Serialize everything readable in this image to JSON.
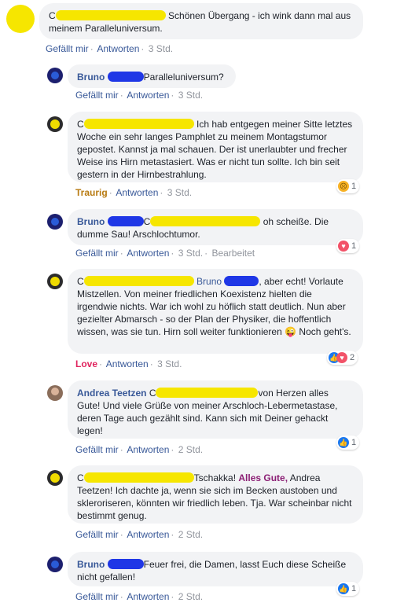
{
  "comments": [
    {
      "text": "Schönen Übergang - ich wink dann mal aus meinem Paralleluniversum.",
      "initial": "C",
      "actions": {
        "like": "Gefällt mir",
        "reply": "Antworten",
        "time": "3 Std."
      }
    },
    {
      "author": "Bruno",
      "text": "Paralleluniversum?",
      "actions": {
        "like": "Gefällt mir",
        "reply": "Antworten",
        "time": "3 Std."
      }
    },
    {
      "initial": "C",
      "text": "Ich hab entgegen meiner Sitte letztes Woche ein sehr langes Pamphlet zu meinem Montagstumor gepostet. Kannst ja mal schauen. Der ist unerlaubter und frecher Weise ins Hirn metastasiert. Was er nicht tun sollte. Ich bin seit gestern in der Hirnbestrahlung.",
      "actions": {
        "reaction": "Traurig",
        "reply": "Antworten",
        "time": "3 Std."
      },
      "badge_count": "1"
    },
    {
      "author": "Bruno",
      "initial": "C",
      "text": "oh scheiße. Die dumme Sau! Arschlochtumor.",
      "actions": {
        "like": "Gefällt mir",
        "reply": "Antworten",
        "time": "3 Std.",
        "edited": "Bearbeitet"
      },
      "badge_count": "1"
    },
    {
      "initial": "C",
      "mention": "Bruno",
      "text": ", aber echt! Vorlaute Mistzellen. Von meiner friedlichen Koexistenz hielten die irgendwie nichts. War ich wohl zu höflich statt deutlich. Nun aber gezielter Abmarsch - so der Plan der Physiker, die hoffentlich wissen, was sie tun. Hirn soll weiter funktionieren",
      "text_end": "Noch geht's.",
      "emoji": "😜",
      "actions": {
        "reaction": "Love",
        "reply": "Antworten",
        "time": "3 Std."
      },
      "badge_count": "2"
    },
    {
      "author": "Andrea Teetzen",
      "initial": "C",
      "text": "von Herzen alles Gute! Und viele Grüße von meiner Arschloch-Lebermetastase, deren Tage auch gezählt sind. Kann sich mit Deiner gehackt legen!",
      "actions": {
        "like": "Gefällt mir",
        "reply": "Antworten",
        "time": "2 Std."
      },
      "badge_count": "1"
    },
    {
      "initial": "C",
      "text_pre": "Tschakka!",
      "highlight": "Alles Gute,",
      "text": "Andrea Teetzen! Ich dachte ja, wenn sie sich im Becken austoben und skleroriseren, könnten wir friedlich leben. Tja. War scheinbar nicht bestimmt genug.",
      "actions": {
        "like": "Gefällt mir",
        "reply": "Antworten",
        "time": "2 Std."
      }
    },
    {
      "author": "Bruno",
      "text": "Feuer frei, die Damen, lasst Euch diese Scheiße nicht gefallen!",
      "actions": {
        "like": "Gefällt mir",
        "reply": "Antworten",
        "time": "2 Std."
      },
      "badge_count": "1"
    }
  ],
  "colors": {
    "name": "#385898",
    "bubble": "#f2f3f5",
    "redaction_yellow": "#f6e600",
    "redaction_blue": "#1f37e6",
    "love": "#e0245e",
    "traurig": "#b87b12",
    "highlight": "#8b1e74"
  }
}
